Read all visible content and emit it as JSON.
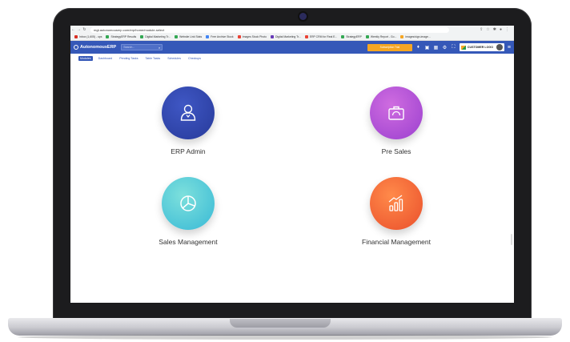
{
  "browser": {
    "url": "mgt.autonomouserp.com/erp/home/module-select",
    "nav": [
      "←",
      "→",
      "↻"
    ],
    "bookmarks": [
      {
        "label": "Inbox (1,605) - ops",
        "color": "#d93025"
      },
      {
        "label": "StrategyERP Results",
        "color": "#34a853"
      },
      {
        "label": "Digital Marketing Tr...",
        "color": "#34a853"
      },
      {
        "label": "Website Link Stats",
        "color": "#34a853"
      },
      {
        "label": "Free Archive Stock",
        "color": "#4285f4"
      },
      {
        "label": "Images Stock Photo",
        "color": "#ea4335"
      },
      {
        "label": "Digital Marketing Tr...",
        "color": "#673ab7"
      },
      {
        "label": "ERP CRM for Real E...",
        "color": "#ea4335"
      },
      {
        "label": "StrategyERP",
        "color": "#34a853"
      },
      {
        "label": "Weekly Report - Go...",
        "color": "#34a853"
      },
      {
        "label": "images/sign-image...",
        "color": "#f5a623"
      }
    ]
  },
  "app": {
    "logo": "AutonomousERP",
    "search_placeholder": "Search...",
    "status_pill": "Subscription Trial",
    "customer_logo": "CUSTOMER LOGO",
    "tabs": [
      "Modules",
      "Dashboard",
      "Pending Tasks",
      "Table Tasks",
      "Schedules",
      "Checkups"
    ],
    "active_tab": "Modules"
  },
  "modules": [
    {
      "label": "ERP Admin",
      "icon": "admin-user-icon",
      "color": "#2f47ad"
    },
    {
      "label": "Pre Sales",
      "icon": "briefcase-icon",
      "color": "#b455d9"
    },
    {
      "label": "Sales Management",
      "icon": "pie-chart-icon",
      "color": "#4cc9d8"
    },
    {
      "label": "Financial Management",
      "icon": "bar-chart-growth-icon",
      "color": "#f2623a"
    }
  ]
}
